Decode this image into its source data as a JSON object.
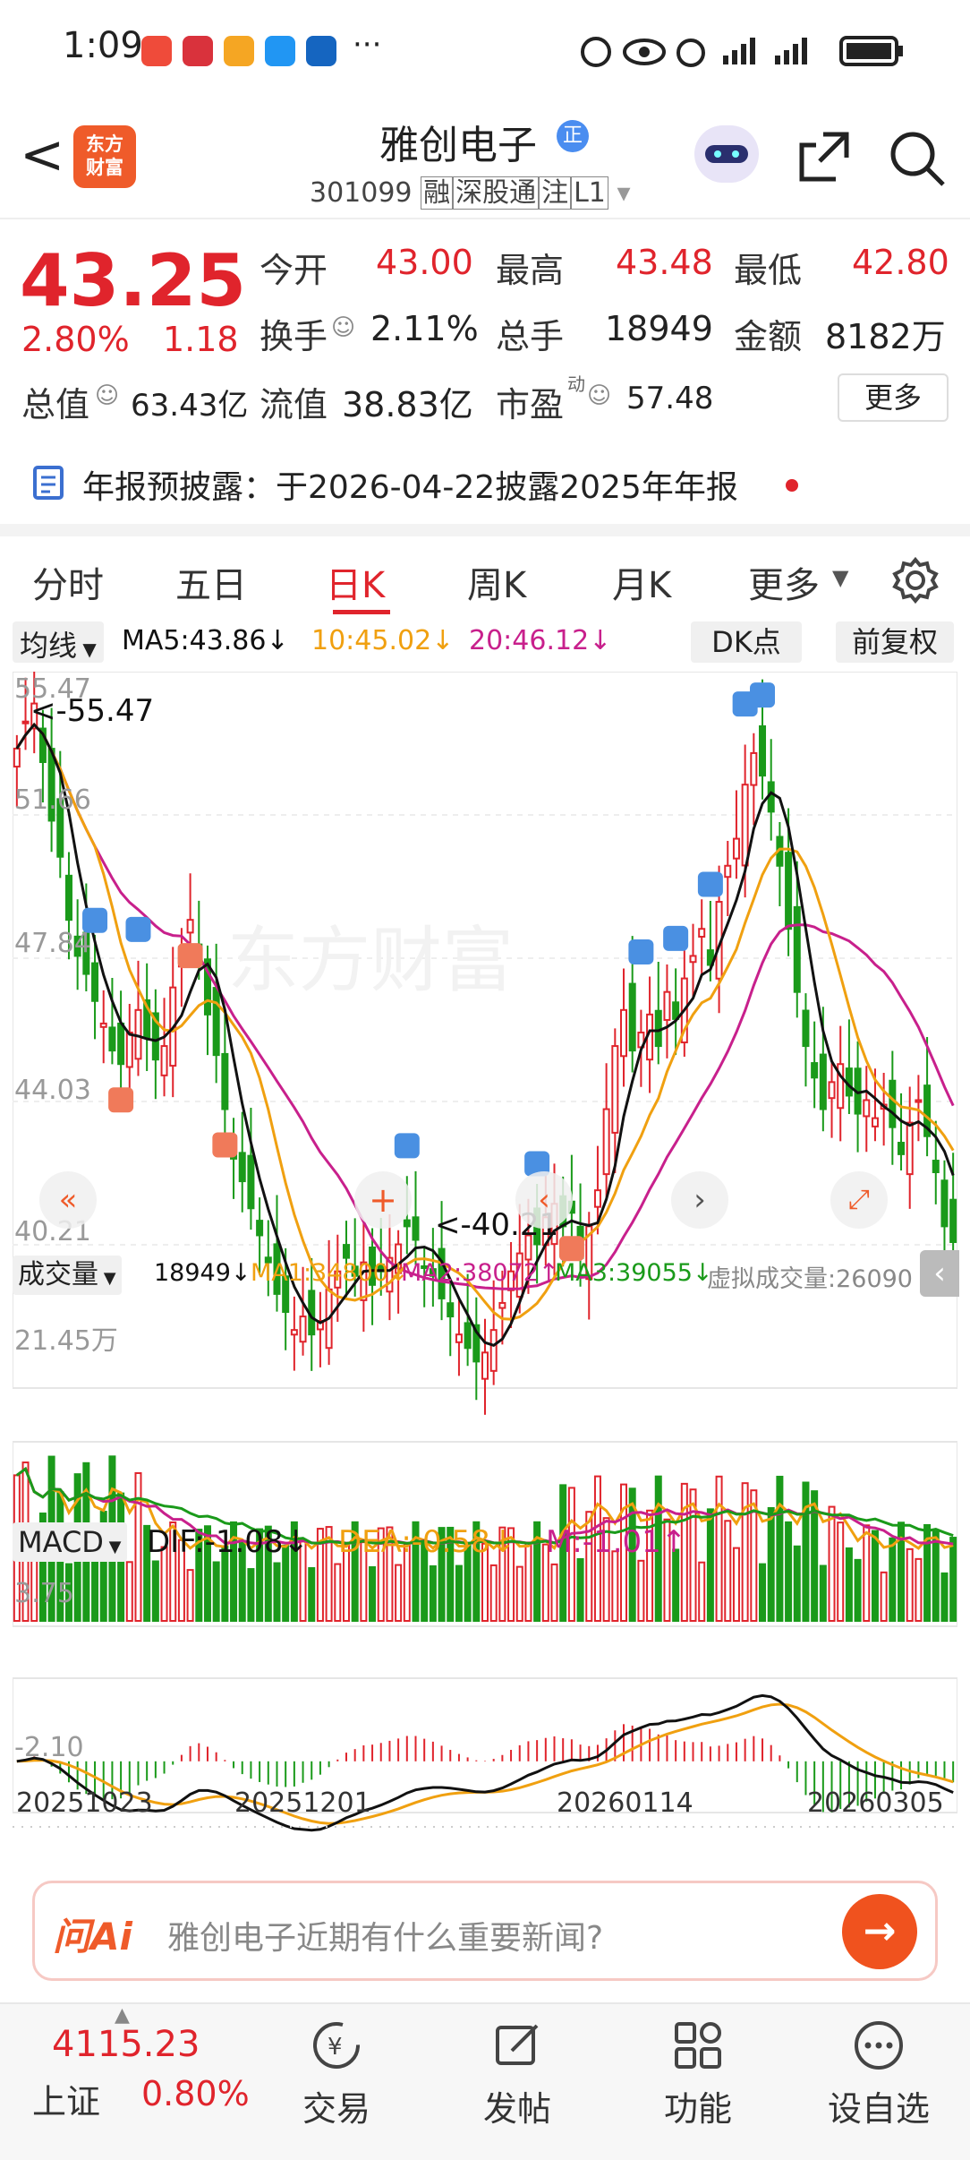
{
  "status_bar": {
    "time": "1:09",
    "more": "···"
  },
  "header": {
    "back": "<",
    "logo_line1": "东方",
    "logo_line2": "财富",
    "stock_name": "雅创电子",
    "tag_zheng": "正",
    "code": "301099",
    "badges": [
      "融",
      "深股通",
      "注",
      "L1"
    ]
  },
  "quote": {
    "price": "43.25",
    "change_pct": "2.80%",
    "change": "1.18",
    "open_label": "今开",
    "open": "43.00",
    "high_label": "最高",
    "high": "43.48",
    "low_label": "最低",
    "low": "42.80",
    "turnover_label": "换手",
    "turnover": "2.11%",
    "volume_label": "总手",
    "volume": "18949",
    "amount_label": "金额",
    "amount": "8182万",
    "mktcap_label": "总值",
    "mktcap": "63.43亿",
    "float_label": "流值",
    "float_cap": "38.83亿",
    "pe_label": "市盈",
    "pe_sup": "动",
    "pe": "57.48",
    "more_button": "更多",
    "notice": "年报预披露：于2026-04-22披露2025年年报"
  },
  "tabs": {
    "items": [
      "分时",
      "五日",
      "日K",
      "周K",
      "月K",
      "更多"
    ],
    "active": "日K"
  },
  "kline": {
    "ma_selector": "均线",
    "ma5": "MA5:43.86↓",
    "ma10": "10:45.02↓",
    "ma20": "20:46.12↓",
    "dk_button": "DK点",
    "adjust_button": "前复权",
    "y_labels": [
      "55.47",
      "51.66",
      "47.84",
      "44.03",
      "40.21"
    ],
    "max_marker": "<-55.47",
    "min_marker": "<-40.21",
    "volume_selector": "成交量",
    "vol_value": "18949↓",
    "vol_ma1": "MA1:34800↓",
    "vol_ma2": "MA2:38072↑",
    "vol_ma3": "MA3:39055↓",
    "vol_virtual": "虚拟成交量:26090",
    "vol_axis": "21.45万",
    "macd_selector": "MACD",
    "dif": "DIF:-1.08↓",
    "dea": "DEA:-0.58↓",
    "m": "M:-1.01↑",
    "macd_top": "3.75",
    "macd_bottom": "-2.10",
    "dates": [
      "20251023",
      "20251201",
      "20260114",
      "20260305"
    ],
    "colors": {
      "up": "#e0242c",
      "down": "#1a9a1a",
      "ma5": "#111111",
      "ma10": "#f0a010",
      "ma20": "#c8208c"
    }
  },
  "chart_data": {
    "type": "candlestick",
    "title": "",
    "ylim": [
      40.21,
      55.47
    ],
    "x": [
      "20251023",
      "20251201",
      "20260114",
      "20260305"
    ],
    "series": [
      {
        "name": "MA5",
        "values": [
          43.86
        ]
      },
      {
        "name": "MA10",
        "values": [
          45.02
        ]
      },
      {
        "name": "MA20",
        "values": [
          46.12
        ]
      }
    ],
    "markers": {
      "high": 55.47,
      "low": 40.21
    }
  },
  "ask_ai": {
    "logo": "问Ai",
    "placeholder": "雅创电子近期有什么重要新闻?"
  },
  "bottom_nav": {
    "index_value": "4115.23",
    "index_name": "上证",
    "index_pct": "0.80%",
    "items": [
      "交易",
      "发帖",
      "功能",
      "设自选"
    ]
  }
}
